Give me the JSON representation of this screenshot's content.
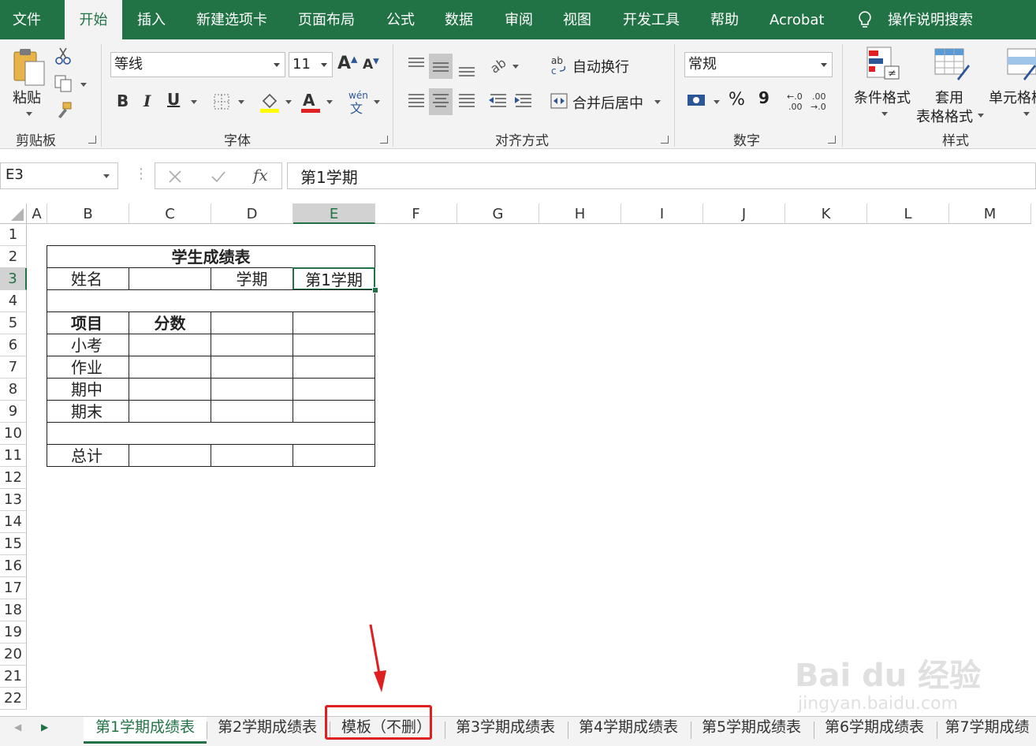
{
  "menu_tabs": [
    "文件",
    "开始",
    "插入",
    "新建选项卡",
    "页面布局",
    "公式",
    "数据",
    "审阅",
    "视图",
    "开发工具",
    "帮助",
    "Acrobat",
    "操作说明搜索"
  ],
  "ribbon": {
    "clipboard": {
      "paste": "粘贴",
      "label": "剪贴板"
    },
    "font": {
      "name": "等线",
      "size": "11",
      "label": "字体",
      "pinyin": "wén",
      "pinyin_char": "文"
    },
    "alignment": {
      "wrap": "自动换行",
      "merge": "合并后居中",
      "label": "对齐方式"
    },
    "number": {
      "format": "常规",
      "percent": "%",
      "comma": "9",
      "label": "数字"
    },
    "styles": {
      "conditional": "条件格式",
      "table1": "套用",
      "table2": "表格格式",
      "cell": "单元格样",
      "label": "样式"
    }
  },
  "formula_bar": {
    "name_box": "E3",
    "fx": "fx",
    "content": "第1学期"
  },
  "columns": [
    "A",
    "B",
    "C",
    "D",
    "E",
    "F",
    "G",
    "H",
    "I",
    "J",
    "K",
    "L",
    "M"
  ],
  "rows": [
    "1",
    "2",
    "3",
    "4",
    "5",
    "6",
    "7",
    "8",
    "9",
    "10",
    "11",
    "12",
    "13",
    "14",
    "15",
    "16",
    "17",
    "18",
    "19",
    "20",
    "21",
    "22"
  ],
  "table": {
    "title": "学生成绩表",
    "name_label": "姓名",
    "term_label": "学期",
    "term_value": "第1学期",
    "item_header": "项目",
    "score_header": "分数",
    "items": [
      "小考",
      "作业",
      "期中",
      "期末"
    ],
    "total": "总计"
  },
  "sheets": [
    "第1学期成绩表",
    "第2学期成绩表",
    "模板（不删）",
    "第3学期成绩表",
    "第4学期成绩表",
    "第5学期成绩表",
    "第6学期成绩表",
    "第7学期成绩"
  ],
  "watermark": {
    "logo": "Bai du 经验",
    "url": "jingyan.baidu.com"
  },
  "colors": {
    "excel_green": "#217346",
    "highlight_red": "#e02020"
  }
}
